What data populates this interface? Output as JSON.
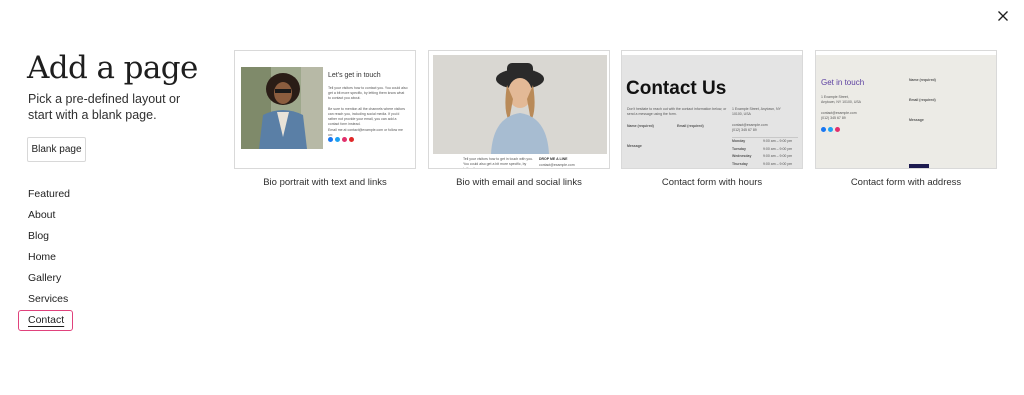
{
  "header": {
    "title": "Add a page",
    "subtitle": "Pick a pre-defined layout or start with a blank page.",
    "close_icon": "close-icon"
  },
  "blank_button": {
    "label": "Blank page"
  },
  "categories": [
    {
      "label": "Featured"
    },
    {
      "label": "About"
    },
    {
      "label": "Blog"
    },
    {
      "label": "Home"
    },
    {
      "label": "Gallery"
    },
    {
      "label": "Services"
    },
    {
      "label": "Contact",
      "active": true
    }
  ],
  "patterns": [
    {
      "label": "Bio portrait with text and links",
      "preview": {
        "heading": "Let's get in touch",
        "para1": "Tell your visitors how to contact you. You could also get a bit more specific, by letting them know what to contact you about.",
        "para2": "Be sure to mention all the channels where visitors can reach you, including social media. If you'd rather not provide your email, you can add a contact form instead.",
        "email_line": "Email me at contact@example.com or follow me on:"
      }
    },
    {
      "label": "Bio with email and social links",
      "preview": {
        "left_text": "Tell your visitors how to get in touch with you. You could also get a bit more specific, by letting them",
        "right_title": "DROP ME A LINE",
        "right_text": "contact@example.com"
      }
    },
    {
      "label": "Contact form with hours",
      "preview": {
        "heading": "Contact Us",
        "intro": "Don't hesitate to reach out with the contact information below, or send a message using the form.",
        "address": "1 Example Street, Anytown, NY 10100, USA",
        "email": "contact@example.com",
        "phone": "(012) 345 67 89",
        "name_label": "Name (required)",
        "email_label": "Email (required)",
        "message_label": "Message",
        "hours": [
          {
            "day": "Monday",
            "time": "9:00 am – 9:00 pm"
          },
          {
            "day": "Tuesday",
            "time": "9:00 am – 9:00 pm"
          },
          {
            "day": "Wednesday",
            "time": "9:00 am – 9:00 pm"
          },
          {
            "day": "Thursday",
            "time": "9:00 am – 9:00 pm"
          }
        ]
      }
    },
    {
      "label": "Contact form with address",
      "preview": {
        "heading": "Get in touch",
        "address1": "1 Example Street,",
        "address2": "Anytown, NY 10100, USA",
        "email": "contact@example.com",
        "phone": "(012) 345 67 89",
        "name_label": "Name (required)",
        "email_label": "Email (required)",
        "message_label": "Message"
      }
    }
  ],
  "colors": {
    "active_border": "#e0427c",
    "link_purple": "#5b3fa0",
    "facebook": "#1877f2",
    "twitter": "#1da1f2",
    "instagram": "#e1306c",
    "youtube": "#e02828"
  }
}
